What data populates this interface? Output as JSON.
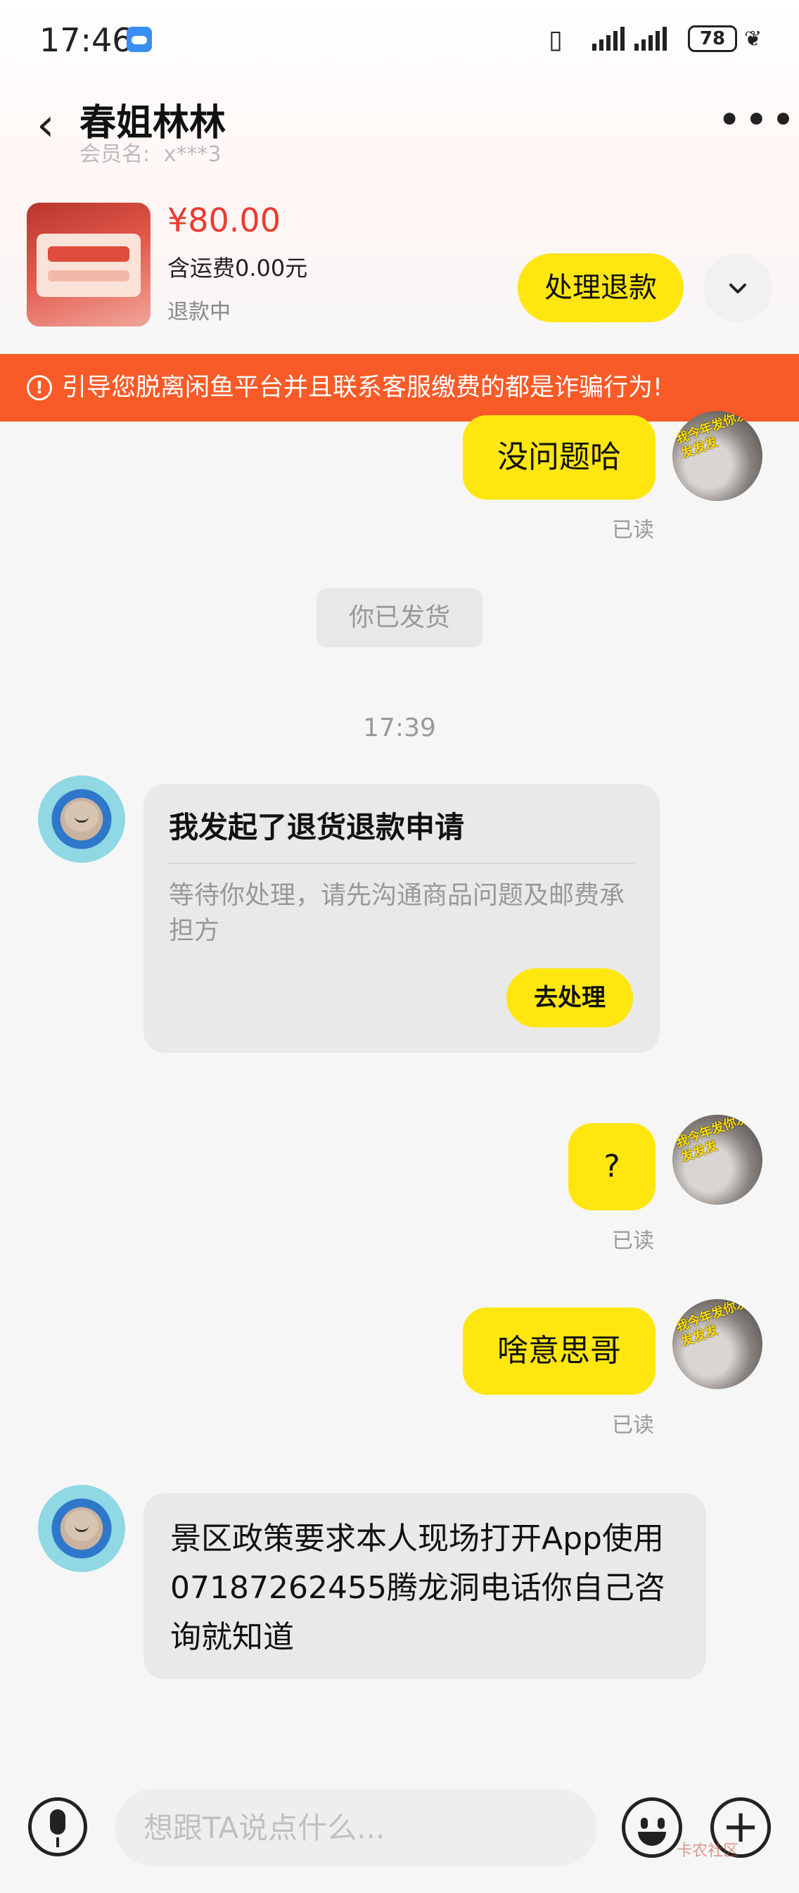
{
  "status_bar": {
    "time": "17:46",
    "battery": "78"
  },
  "header": {
    "back_icon": "‹",
    "contact_name": "春姐林林",
    "member_label": "会员名:",
    "member_id": "x***3",
    "more_icon": "•••"
  },
  "product": {
    "price": "¥80.00",
    "shipping": "含运费0.00元",
    "status": "退款中",
    "refund_button": "处理退款",
    "expand_icon": "chevron-down"
  },
  "warning": {
    "icon": "!",
    "text": "引导您脱离闲鱼平台并且联系客服缴费的都是诈骗行为!"
  },
  "messages": {
    "m1": {
      "text": "没问题哈",
      "read": "已读"
    },
    "shipped_note": "你已发货",
    "time": "17:39",
    "refund_card": {
      "title": "我发起了退货退款申请",
      "body": "等待你处理，请先沟通商品问题及邮费承担方",
      "action": "去处理"
    },
    "m2": {
      "text": "?",
      "read": "已读"
    },
    "m3": {
      "text": "啥意思哥",
      "read": "已读"
    },
    "m4": {
      "text": "景区政策要求本人现场打开App使用 07187262455腾龙洞电话你自己咨询就知道"
    }
  },
  "avatar_me_overlay": "我今年发你发发发发",
  "input": {
    "placeholder": "想跟TA说点什么..."
  },
  "watermark": "卡农社区",
  "colors": {
    "accent_yellow": "#ffe60f",
    "warning": "#f85a28",
    "price": "#ec3b2f"
  }
}
